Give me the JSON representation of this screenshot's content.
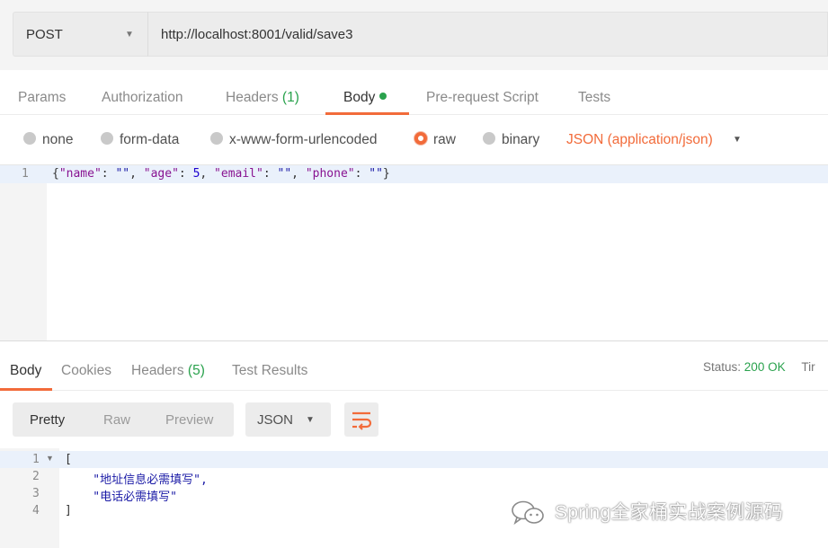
{
  "request": {
    "method": "POST",
    "url": "http://localhost:8001/valid/save3"
  },
  "request_tabs": [
    {
      "label": "Params"
    },
    {
      "label": "Authorization"
    },
    {
      "label": "Headers",
      "count": "(1)"
    },
    {
      "label": "Body",
      "active": true
    },
    {
      "label": "Pre-request Script"
    },
    {
      "label": "Tests"
    }
  ],
  "body_types": {
    "options": [
      "none",
      "form-data",
      "x-www-form-urlencoded",
      "raw",
      "binary"
    ],
    "selected": "raw",
    "content_type": "JSON (application/json)"
  },
  "request_body": {
    "line_number": "1",
    "tokens": [
      "{",
      "\"name\"",
      ": ",
      "\"\"",
      ", ",
      "\"age\"",
      ": ",
      "5",
      ", ",
      "\"email\"",
      ": ",
      "\"\"",
      ", ",
      "\"phone\"",
      ": ",
      "\"\"",
      "}"
    ]
  },
  "response_tabs": [
    {
      "label": "Body",
      "active": true
    },
    {
      "label": "Cookies"
    },
    {
      "label": "Headers",
      "count": "(5)"
    },
    {
      "label": "Test Results"
    }
  ],
  "response_status": {
    "label": "Status:",
    "code": "200 OK",
    "next_label": "Tir"
  },
  "response_view": {
    "modes": [
      "Pretty",
      "Raw",
      "Preview"
    ],
    "active_mode": "Pretty",
    "format": "JSON"
  },
  "response_body": {
    "lines": [
      {
        "num": "1",
        "text": "["
      },
      {
        "num": "2",
        "text": "    \"地址信息必需填写\","
      },
      {
        "num": "3",
        "text": "    \"电话必需填写\""
      },
      {
        "num": "4",
        "text": "]"
      }
    ]
  },
  "watermark": {
    "text": "Spring全家桶实战案例源码"
  },
  "colors": {
    "accent": "#f26b3a",
    "success": "#2aa24d"
  }
}
